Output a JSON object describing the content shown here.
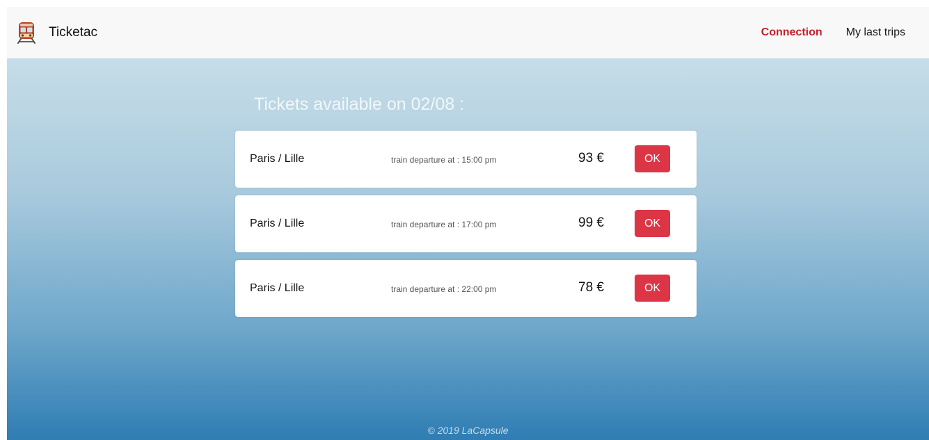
{
  "navbar": {
    "brand_icon": "train-icon",
    "brand_name": "Ticketac",
    "links": [
      {
        "label": "Connection",
        "active": true
      },
      {
        "label": "My last trips",
        "active": false
      }
    ],
    "active_color": "#c4202a"
  },
  "main": {
    "heading": "Tickets available on 02/08 :",
    "tickets": [
      {
        "route": "Paris / Lille",
        "departure": "train departure at : 15:00 pm",
        "price": "93 €",
        "button": "OK"
      },
      {
        "route": "Paris / Lille",
        "departure": "train departure at : 17:00 pm",
        "price": "99 €",
        "button": "OK"
      },
      {
        "route": "Paris / Lille",
        "departure": "train departure at : 22:00 pm",
        "price": "78 €",
        "button": "OK"
      }
    ],
    "button_color": "#dc3545"
  },
  "footer": {
    "text": "© 2019 LaCapsule"
  }
}
